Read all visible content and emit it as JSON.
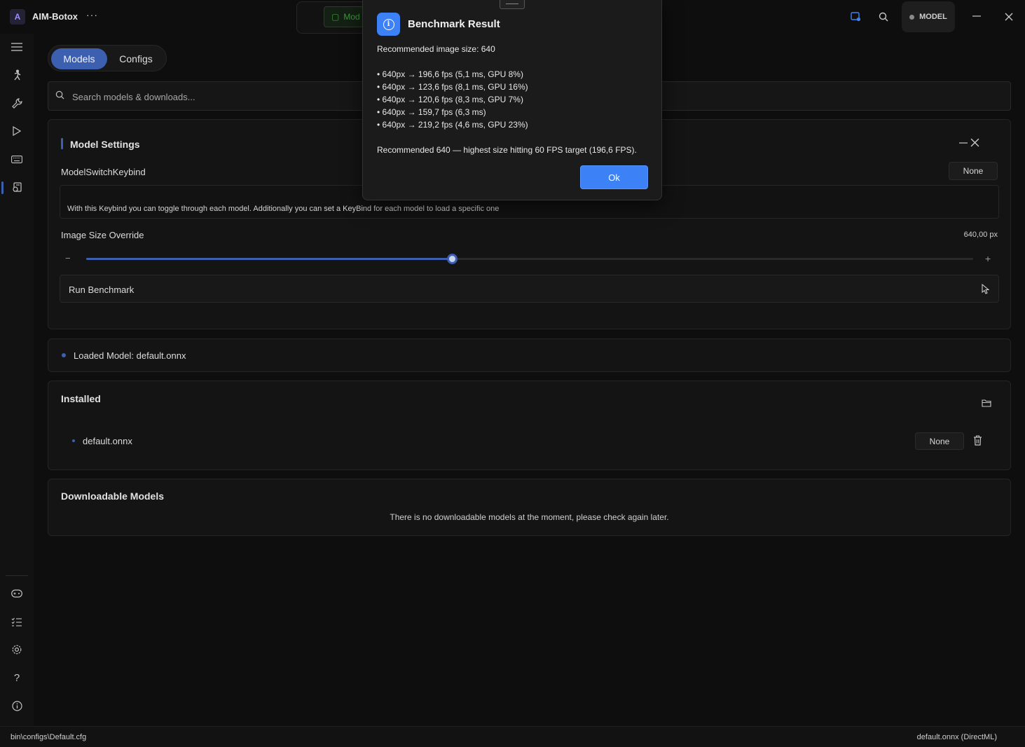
{
  "app": {
    "title": "AIM-Botox",
    "logo_text": "A",
    "more": "···"
  },
  "titlebar": {
    "center_item": "Mod",
    "model_chip": "MODEL",
    "icons": [
      "window-icon",
      "search-icon",
      "minimize-icon",
      "close-icon"
    ]
  },
  "sidebar": {
    "top_icons": [
      "menu-icon",
      "aim-icon",
      "wrench-icon",
      "play-icon",
      "keyboard-icon",
      "model-icon"
    ],
    "bottom_icons": [
      "gamepad-icon",
      "checklist-icon",
      "gear-icon",
      "help-icon",
      "info-icon"
    ]
  },
  "tabs": {
    "models": "Models",
    "configs": "Configs"
  },
  "search": {
    "placeholder": "Search models & downloads..."
  },
  "model_settings": {
    "title": "Model Settings",
    "keybind_label": "ModelSwitchKeybind",
    "keybind_value": "None",
    "keybind_help": "With this Keybind you can toggle through each model. Additionally you can set a KeyBind for each model to load a specific one",
    "image_size_label": "Image Size Override",
    "image_size_value": "640,00 px",
    "slider_fraction": 0.412,
    "minus": "−",
    "plus": "+",
    "run_benchmark": "Run Benchmark"
  },
  "loaded_model": {
    "text": "Loaded Model: default.onnx"
  },
  "installed": {
    "title": "Installed",
    "items": [
      {
        "name": "default.onnx",
        "keybind": "None"
      }
    ]
  },
  "downloadable": {
    "title": "Downloadable Models",
    "empty": "There is no downloadable models at the moment, please check again later."
  },
  "statusbar": {
    "left": "bin\\configs\\Default.cfg",
    "right": "default.onnx (DirectML)"
  },
  "modal": {
    "title": "Benchmark Result",
    "recommended": "Recommended image size: 640",
    "results": [
      "• 640px → 196,6 fps (5,1 ms, GPU 8%)",
      "• 640px → 123,6 fps (8,1 ms, GPU 16%)",
      "• 640px → 120,6 fps (8,3 ms, GPU 7%)",
      "• 640px → 159,7 fps (6,3 ms)",
      "• 640px → 219,2 fps (4,6 ms, GPU 23%)"
    ],
    "summary": "Recommended 640 — highest size hitting 60 FPS target (196,6 FPS).",
    "ok": "Ok"
  },
  "colors": {
    "accent": "#3d5fb0",
    "dialog_button": "#3c82f6",
    "background": "#0e0e0e"
  }
}
